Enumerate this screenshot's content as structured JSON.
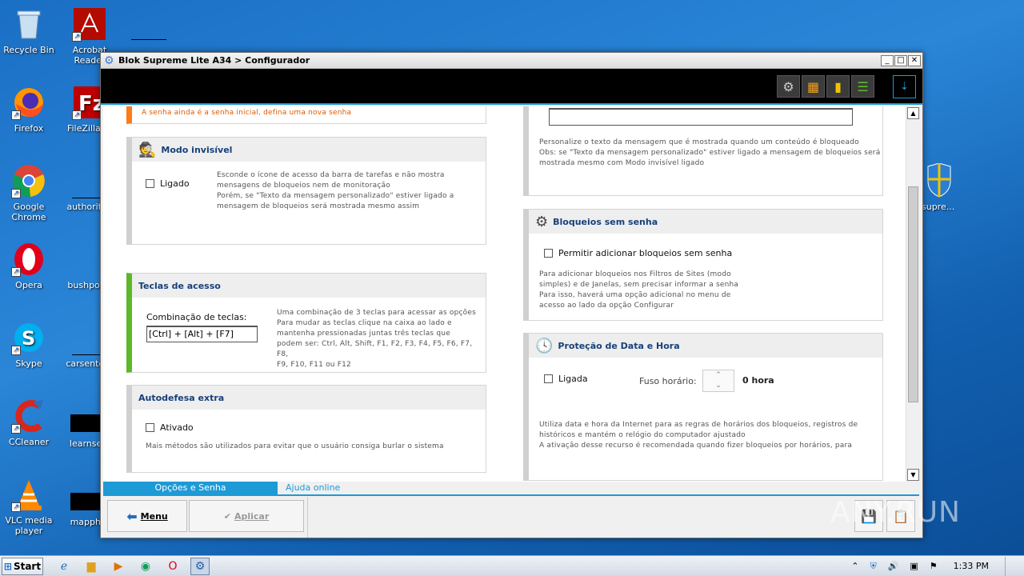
{
  "desktop": {
    "icons": [
      {
        "label": "Recycle Bin",
        "icon": "recycle-bin-icon"
      },
      {
        "label": "Acrobat Reader",
        "icon": "acrobat-icon"
      },
      {
        "label": "Firefox",
        "icon": "firefox-icon"
      },
      {
        "label": "FileZilla Cl",
        "icon": "filezilla-icon"
      },
      {
        "label": "Google Chrome",
        "icon": "chrome-icon"
      },
      {
        "label": "authorityn",
        "icon": "document-icon"
      },
      {
        "label": "Opera",
        "icon": "opera-icon"
      },
      {
        "label": "bushporn.",
        "icon": "document-icon"
      },
      {
        "label": "Skype",
        "icon": "skype-icon"
      },
      {
        "label": "carsenterp",
        "icon": "document-icon"
      },
      {
        "label": "CCleaner",
        "icon": "ccleaner-icon"
      },
      {
        "label": "learnsex.",
        "icon": "document-icon"
      },
      {
        "label": "VLC media player",
        "icon": "vlc-icon"
      },
      {
        "label": "mapphp.",
        "icon": "document-icon"
      },
      {
        "label": "supre...",
        "icon": "shield-icon"
      }
    ]
  },
  "window": {
    "title": "Blok Supreme Lite A34 > Configurador",
    "controls": [
      "_",
      "□",
      "✕"
    ]
  },
  "toolbar": {
    "download_label": "⇣"
  },
  "left": {
    "senha_warning": "A senha ainda é a senha inicial, defina uma nova senha",
    "modo_invisivel": {
      "title": "Modo invisível",
      "checkbox": "Ligado",
      "desc1": "Esconde o ícone de acesso da barra de tarefas e não mostra",
      "desc2": "mensagens de bloqueios nem de monitoração",
      "desc3": "Porém, se \"Texto da mensagem personalizado\" estiver ligado a",
      "desc4": "mensagem de bloqueios será mostrada mesmo assim"
    },
    "teclas": {
      "title": "Teclas de acesso",
      "combo_label": "Combinação de teclas:",
      "combo_value": "[Ctrl] + [Alt] + [F7]",
      "desc1": "Uma combinação de 3 teclas para acessar as opções",
      "desc2": "Para mudar as teclas clique na caixa ao lado e",
      "desc3": "mantenha pressionadas juntas três teclas que",
      "desc4": "podem ser: Ctrl, Alt, Shift, F1, F2, F3, F4, F5, F6, F7, F8,",
      "desc5": "F9, F10, F11 ou F12"
    },
    "autodefesa": {
      "title": "Autodefesa extra",
      "checkbox": "Ativado",
      "desc": "Mais métodos são utilizados para evitar que o usuário consiga burlar o sistema"
    }
  },
  "right": {
    "mensagem": {
      "desc1": "Personalize o texto da mensagem que é mostrada quando um conteúdo é bloqueado",
      "desc2": "Obs: se \"Texto da mensagem personalizado\" estiver ligado a mensagem de bloqueios será",
      "desc3": "mostrada mesmo com Modo invisível ligado"
    },
    "bloqueios": {
      "title": "Bloqueios sem senha",
      "checkbox": "Permitir adicionar bloqueios sem senha",
      "desc1": "Para adicionar bloqueios nos Filtros de Sites (modo",
      "desc2": "simples) e de Janelas, sem precisar informar a senha",
      "desc3": "Para isso, haverá uma opção adicional no menu de",
      "desc4": "acesso ao lado da opção Configurar"
    },
    "protecao": {
      "title": "Proteção de Data e Hora",
      "checkbox": "Ligada",
      "fuso_label": "Fuso horário:",
      "fuso_value": "0 hora",
      "desc1": "Utiliza data e hora da Internet para as regras de horários dos bloqueios, registros de",
      "desc2": "históricos e mantém o relógio do computador ajustado",
      "desc3": "A ativação desse recurso é recomendada quando fizer bloqueios por horários, para"
    }
  },
  "tabs": {
    "active": "Opções e Senha",
    "link": "Ajuda online"
  },
  "footer": {
    "menu": "Menu",
    "apply": "Aplicar"
  },
  "watermark": "ANY.RUN",
  "taskbar": {
    "start": "Start",
    "clock": "1:33 PM"
  },
  "colors": {
    "accent": "#1e9ad6",
    "green_bar": "#5cb82a",
    "orange_bar": "#ff7a1a",
    "warning_text": "#e05a00"
  }
}
